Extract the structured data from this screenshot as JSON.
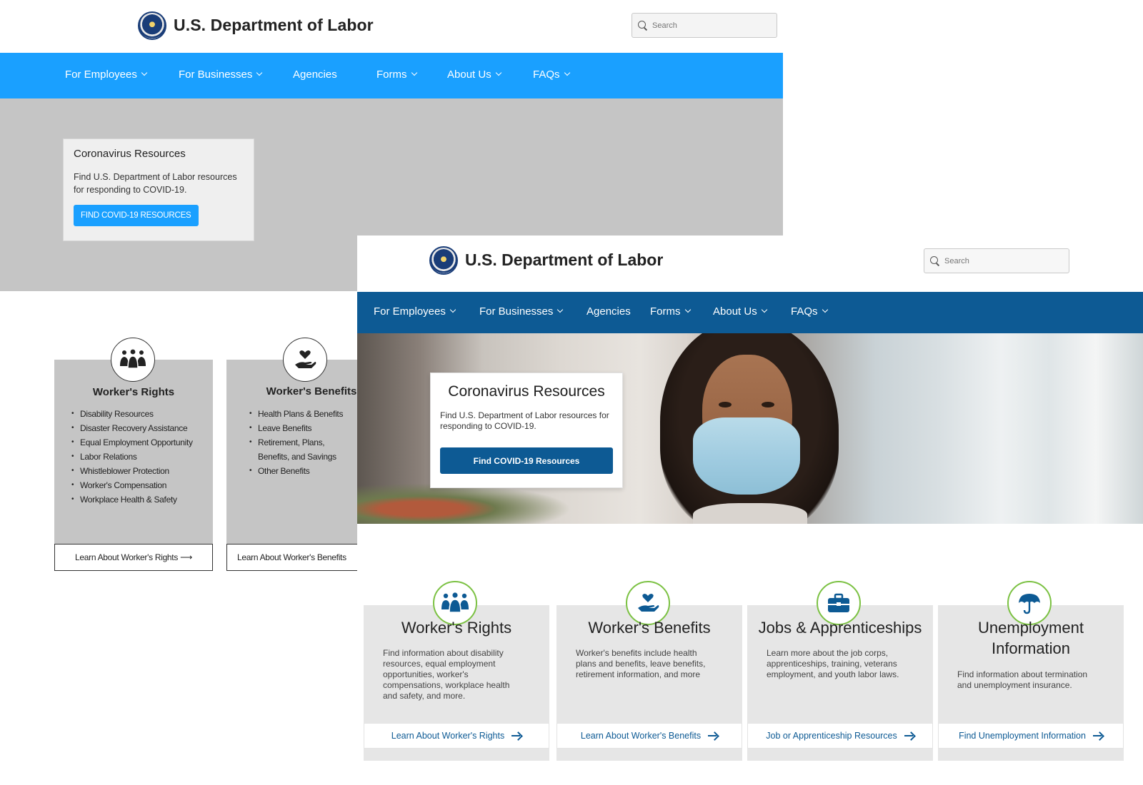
{
  "brand": {
    "name": "U.S. Department of Labor"
  },
  "search": {
    "placeholder": "Search"
  },
  "nav": {
    "items": [
      "For Employees",
      "For Businesses",
      "Agencies",
      "Forms",
      "About Us",
      "FAQs"
    ]
  },
  "covid": {
    "title": "Coronavirus Resources",
    "text": "Find U.S. Department of Labor resources for responding to COVID-19.",
    "wireframe_button": "FIND COVID-19 RESOURCES",
    "button": "Find COVID-19 Resources"
  },
  "wireframe_cards": [
    {
      "title": "Worker's Rights",
      "items": [
        "Disability Resources",
        "Disaster Recovery Assistance",
        "Equal Employment Opportunity",
        "Labor Relations",
        "Whistleblower Protection",
        "Worker's Compensation",
        "Workplace Health & Safety"
      ],
      "button": "Learn About Worker's Rights ⟶"
    },
    {
      "title": "Worker's Benefits",
      "items": [
        "Health Plans & Benefits",
        "Leave Benefits",
        "Retirement, Plans, Benefits, and Savings",
        "Other Benefits"
      ],
      "button": "Learn About Worker's Benefits"
    }
  ],
  "cards": [
    {
      "title": "Worker's Rights",
      "text": "Find information about disability resources, equal employment opportunities, worker's compensations, workplace health and safety, and more.",
      "link": "Learn About Worker's Rights"
    },
    {
      "title": "Worker's Benefits",
      "text": "Worker's benefits include health plans and benefits, leave benefits, retirement information, and more",
      "link": "Learn About Worker's Benefits"
    },
    {
      "title": "Jobs & Apprenticeships",
      "text": "Learn more about the job corps, apprenticeships, training, veterans employment, and youth labor laws.",
      "link": "Job or Apprenticeship Resources"
    },
    {
      "title": "Unemployment Information",
      "text": "Find information about termination and unemployment insurance.",
      "link": "Find Unemployment Information"
    }
  ],
  "icons": {
    "workers_rights": "group-people-icon",
    "workers_benefits": "hand-heart-icon",
    "jobs": "briefcase-icon",
    "unemployment": "umbrella-icon"
  },
  "colors": {
    "wireframe_nav": "#1aa0ff",
    "final_nav": "#0d5a94",
    "accent_green": "#7bc142"
  }
}
